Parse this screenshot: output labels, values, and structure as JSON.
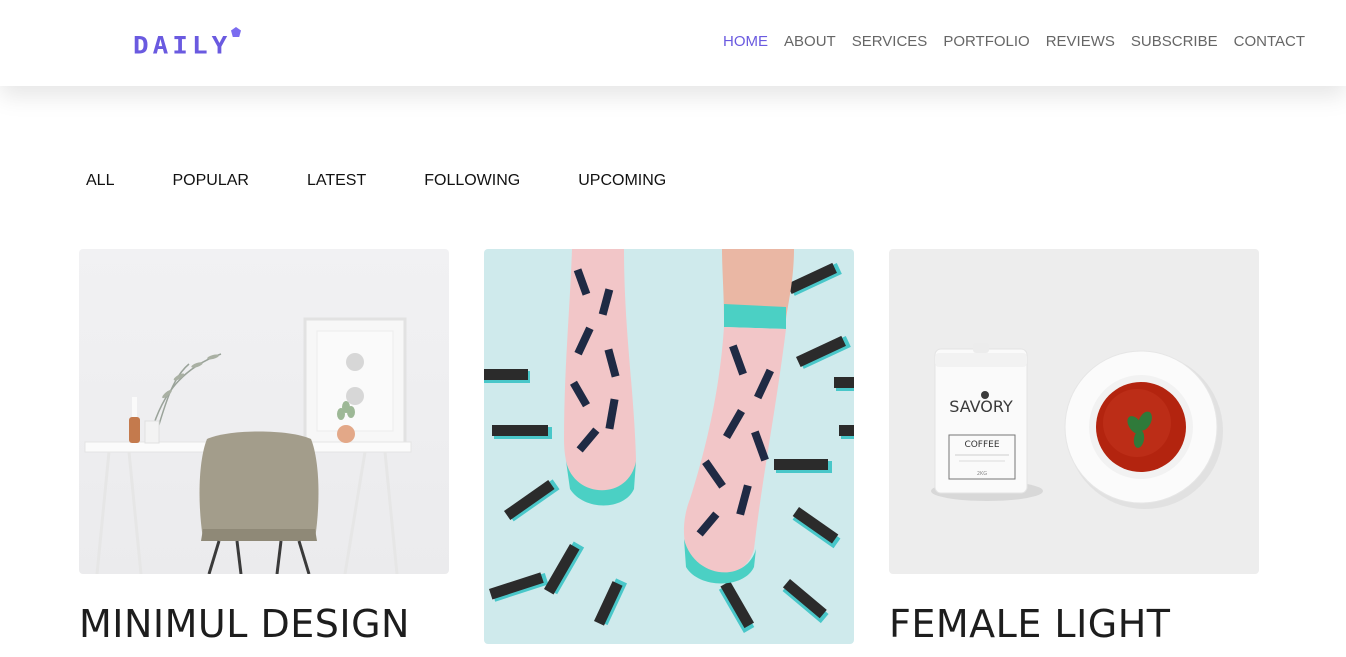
{
  "brand": {
    "logo_text": "DAILY",
    "accent_color": "#6a5ae0"
  },
  "nav": {
    "items": [
      {
        "label": "HOME",
        "active": true
      },
      {
        "label": "ABOUT",
        "active": false
      },
      {
        "label": "SERVICES",
        "active": false
      },
      {
        "label": "PORTFOLIO",
        "active": false
      },
      {
        "label": "REVIEWS",
        "active": false
      },
      {
        "label": "SUBSCRIBE",
        "active": false
      },
      {
        "label": "CONTACT",
        "active": false
      }
    ]
  },
  "filters": {
    "items": [
      "ALL",
      "POPULAR",
      "LATEST",
      "FOLLOWING",
      "UPCOMING"
    ]
  },
  "portfolio": {
    "cards": [
      {
        "title": "MINIMUL DESIGN",
        "image": "desk-with-chair-photo"
      },
      {
        "title": "",
        "image": "patterned-socks-photo"
      },
      {
        "title": "FEMALE LIGHT",
        "image": "coffee-tin-and-soup-bowl-photo"
      }
    ],
    "product": {
      "brand_label": "SAVORY",
      "product_label": "COFFEE",
      "weight_label": "2KG"
    }
  }
}
